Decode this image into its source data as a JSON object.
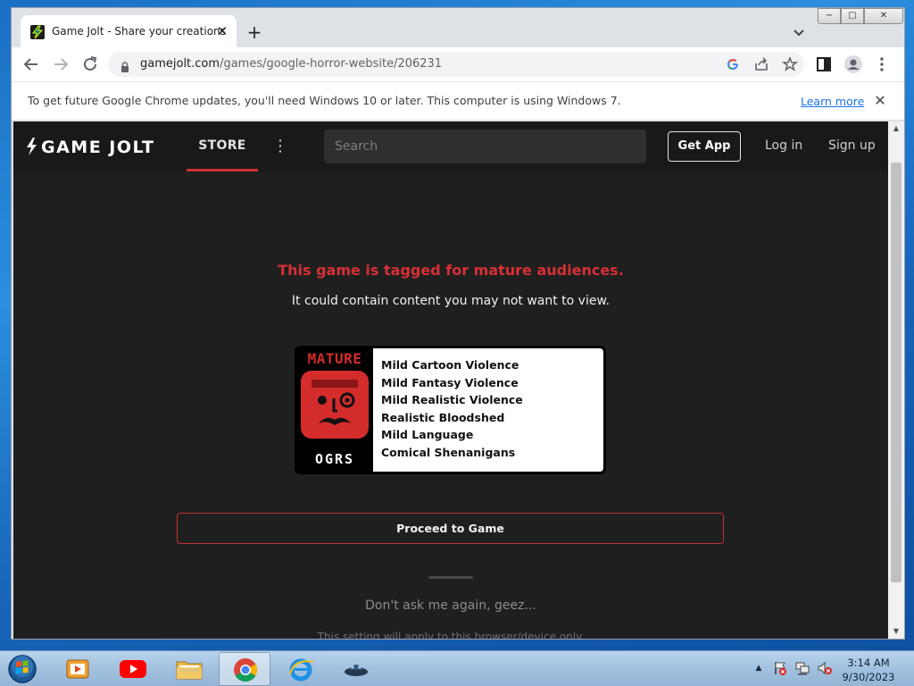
{
  "browser": {
    "tab_title": "Game Jolt - Share your creations",
    "tab_close": "✕",
    "new_tab": "+",
    "address": "gamejolt.com",
    "address_path": "/games/google-horror-website/206231",
    "infobar_text": "To get future Google Chrome updates, you'll need Windows 10 or later. This computer is using Windows 7.",
    "infobar_link": "Learn more",
    "infobar_close": "✕",
    "window_min": "−",
    "window_max": "▢",
    "window_close": "✕",
    "icons": [
      "back-icon",
      "forward-icon",
      "reload-icon",
      "lock-icon",
      "google-icon",
      "share-icon",
      "star-icon",
      "side-panel-icon",
      "profile-icon",
      "menu-icon"
    ]
  },
  "site": {
    "logo_text": "GAME JOLT",
    "nav_store": "STORE",
    "nav_more": "⋮",
    "search_placeholder": "Search",
    "get_app": "Get App",
    "log_in": "Log in",
    "sign_up": "Sign up",
    "accent_color": "#cc3133"
  },
  "warning": {
    "title": "This game is tagged for mature audiences.",
    "subtitle": "It could contain content you may not want to view.",
    "badge_top": "MATURE",
    "badge_bottom": "OGRS",
    "descriptors": [
      "Mild Cartoon Violence",
      "Mild Fantasy Violence",
      "Mild Realistic Violence",
      "Realistic Bloodshed",
      "Mild Language",
      "Comical Shenanigans"
    ],
    "proceed": "Proceed to Game",
    "dont_ask": "Don't ask me again, geez...",
    "setting_note": "This setting will apply to this browser/device only."
  },
  "taskbar": {
    "time": "3:14 AM",
    "date": "9/30/2023",
    "tray_arrow": "▲",
    "pinned": [
      "media-player-icon",
      "youtube-icon",
      "explorer-icon",
      "chrome-icon",
      "ie-icon",
      "gamejolt-app-icon"
    ]
  }
}
